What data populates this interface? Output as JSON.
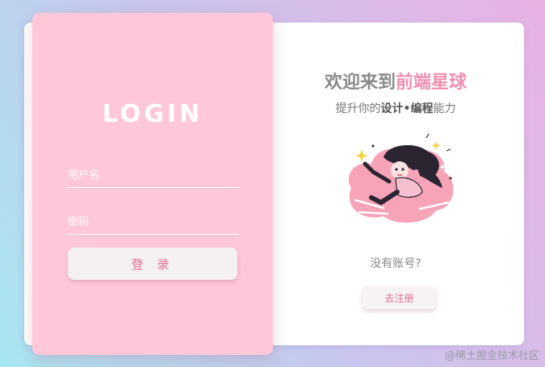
{
  "colors": {
    "accent_pink": "#f08fb0",
    "panel_pink": "#ffc8d8",
    "button_text": "#e26d93"
  },
  "login": {
    "title": "LOGIN",
    "username_placeholder": "用户名",
    "password_placeholder": "密码",
    "submit_label": "登 录"
  },
  "welcome": {
    "title_prefix": "欢迎来到",
    "title_highlight": "前端星球",
    "subtitle_prefix": "提升你的",
    "subtitle_bold": "设计•编程",
    "subtitle_suffix": "能力",
    "illustration": "flying-girl-illustration"
  },
  "register": {
    "prompt": "没有账号?",
    "button_label": "去注册"
  },
  "watermark": "@稀土掘金技术社区"
}
